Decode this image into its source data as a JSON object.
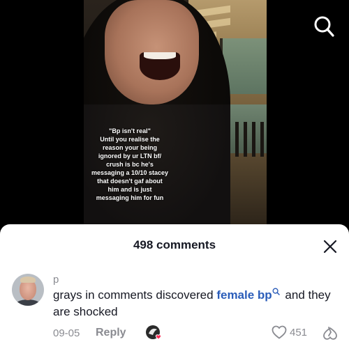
{
  "video": {
    "caption": "\"Bp isn't real\"\nUntil you realise the reason your being ignored by ur LTN bf/ crush is bc he's messaging a 10/10 stacey that doesn't gaf about him and is just messaging him for fun",
    "search_icon": "search-icon"
  },
  "comments_sheet": {
    "title": "498 comments",
    "close_icon": "close-icon",
    "comments": [
      {
        "username": "p",
        "text_before": "grays in comments discovered ",
        "link_text": "female bp",
        "text_after": " and they are shocked",
        "date": "09-05",
        "reply_label": "Reply",
        "like_count": "451",
        "link_color": "#2b5db9"
      }
    ]
  }
}
